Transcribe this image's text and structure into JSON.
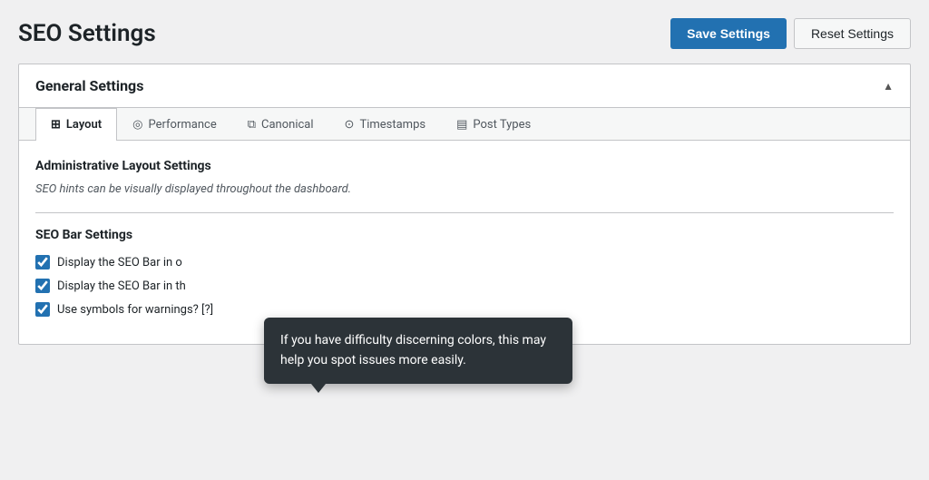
{
  "page": {
    "title": "SEO Settings"
  },
  "header": {
    "save_label": "Save Settings",
    "reset_label": "Reset Settings"
  },
  "general_settings": {
    "title": "General Settings",
    "tabs": [
      {
        "id": "layout",
        "icon": "⊞",
        "label": "Layout",
        "active": true
      },
      {
        "id": "performance",
        "icon": "◎",
        "label": "Performance",
        "active": false
      },
      {
        "id": "canonical",
        "icon": "⧉",
        "label": "Canonical",
        "active": false
      },
      {
        "id": "timestamps",
        "icon": "⊙",
        "label": "Timestamps",
        "active": false
      },
      {
        "id": "post-types",
        "icon": "▤",
        "label": "Post Types",
        "active": false
      }
    ],
    "layout_tab": {
      "admin_section_title": "Administrative Layout Settings",
      "admin_hint": "SEO hints can be visually displayed throughout the dashboard.",
      "seo_bar_title": "SEO Bar Settings",
      "checkboxes": [
        {
          "id": "cb1",
          "label": "Display the SEO Bar in o",
          "checked": true
        },
        {
          "id": "cb2",
          "label": "Display the SEO Bar in th",
          "checked": true
        },
        {
          "id": "cb3",
          "label": "Use symbols for warnings? [?]",
          "checked": true
        }
      ]
    }
  },
  "tooltip": {
    "text": "If you have difficulty discerning colors, this may help you spot issues more easily."
  }
}
